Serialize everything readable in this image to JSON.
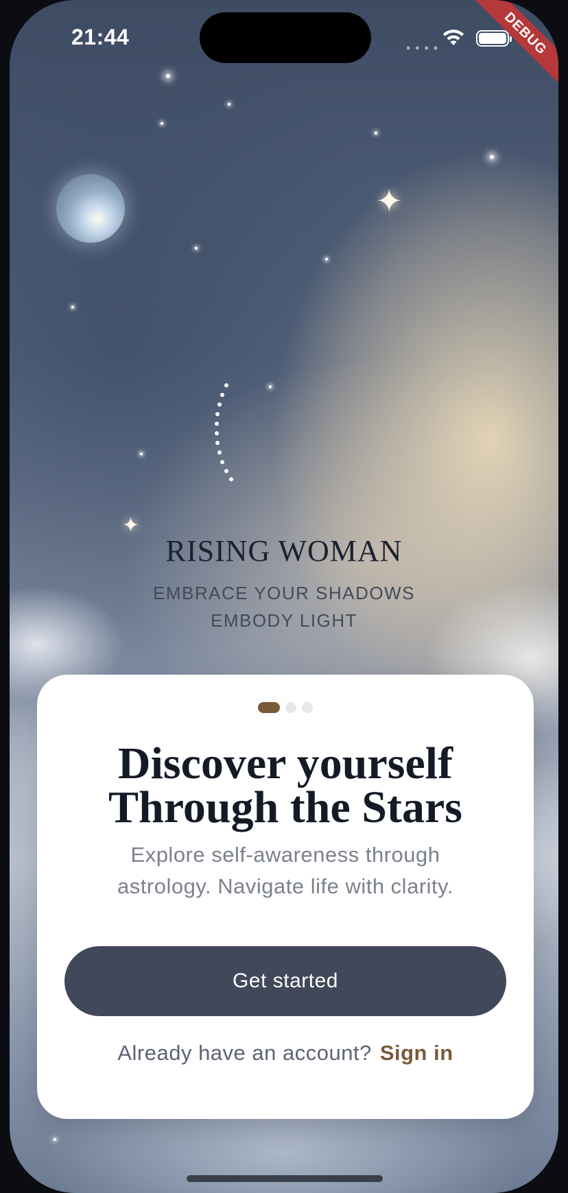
{
  "status_bar": {
    "time": "21:44",
    "signal_icon": "signal-dots-icon",
    "wifi_icon": "wifi-icon",
    "battery_icon": "battery-icon"
  },
  "debug_banner": "DEBUG",
  "logo": {
    "icon": "crescent-moon-icon",
    "brand": "RISING WOMAN",
    "tagline_line1": "EMBRACE YOUR SHADOWS",
    "tagline_line2": "EMBODY LIGHT"
  },
  "onboarding": {
    "page_indicator": {
      "count": 3,
      "active_index": 0
    },
    "headline_line1": "Discover yourself",
    "headline_line2": "Through the Stars",
    "subtitle_line1": "Explore self-awareness through",
    "subtitle_line2": "astrology. Navigate life with clarity.",
    "cta_label": "Get started",
    "account_prompt": "Already have an account?",
    "signin_label": "Sign in"
  },
  "colors": {
    "accent_brown": "#7a5a3a",
    "button_slate": "#41485a",
    "card_bg": "#ffffff"
  }
}
